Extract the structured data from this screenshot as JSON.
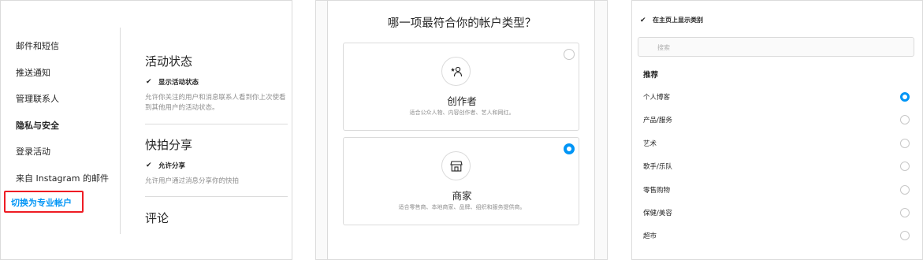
{
  "settings": {
    "nav": [
      {
        "label": "邮件和短信"
      },
      {
        "label": "推送通知"
      },
      {
        "label": "管理联系人"
      },
      {
        "label": "隐私与安全"
      },
      {
        "label": "登录活动"
      },
      {
        "label": "来自 Instagram 的邮件"
      },
      {
        "label": "切换为专业帐户"
      }
    ],
    "activity": {
      "title": "活动状态",
      "checkbox_label": "显示活动状态",
      "help": "允许你关注的用户和消息联系人看到你上次使看到其他用户的活动状态。"
    },
    "story_share": {
      "title": "快拍分享",
      "checkbox_label": "允许分享",
      "help": "允许用户通过消息分享你的快拍"
    },
    "comments": {
      "title": "评论"
    }
  },
  "account_type": {
    "title": "哪一项最符合你的帐户类型？",
    "options": [
      {
        "name": "创作者",
        "desc": "适合公众人物、内容创作者、艺人和网红。",
        "icon": "creator-icon",
        "selected": false
      },
      {
        "name": "商家",
        "desc": "适合零售商、本地商家、品牌、组织和服务提供商。",
        "icon": "shop-icon",
        "selected": true
      }
    ]
  },
  "category": {
    "show_on_profile_label": "在主页上显示类别",
    "search_placeholder": "搜索",
    "suggested_title": "推荐",
    "items": [
      {
        "label": "个人博客",
        "selected": true
      },
      {
        "label": "产品/服务",
        "selected": false
      },
      {
        "label": "艺术",
        "selected": false
      },
      {
        "label": "歌手/乐队",
        "selected": false
      },
      {
        "label": "零售购物",
        "selected": false
      },
      {
        "label": "保健/美容",
        "selected": false
      },
      {
        "label": "超市",
        "selected": false
      }
    ]
  },
  "colors": {
    "accent": "#0095f6",
    "highlight_border": "#ee1c24",
    "text": "#262626",
    "muted": "#8e8e8e",
    "border": "#dbdbdb"
  }
}
